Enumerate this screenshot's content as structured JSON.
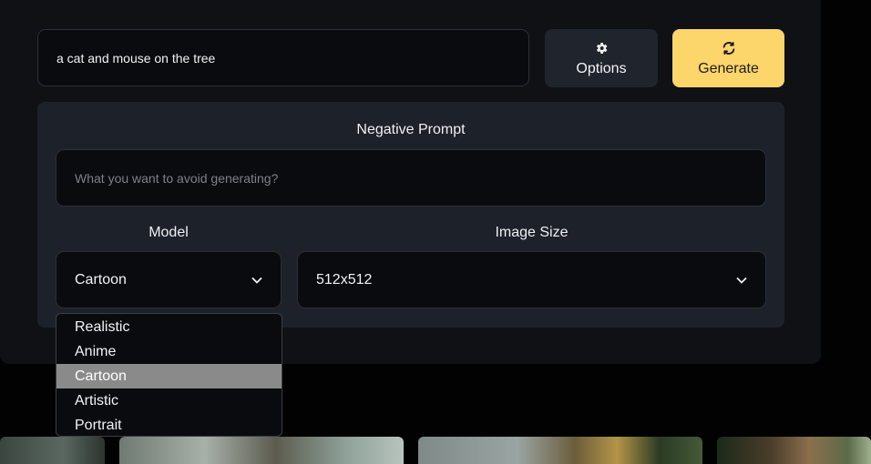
{
  "prompt": {
    "value": "a cat and mouse on the tree"
  },
  "buttons": {
    "options": {
      "label": "Options",
      "icon": "gear-icon"
    },
    "generate": {
      "label": "Generate",
      "icon": "refresh-icon"
    }
  },
  "negative_prompt": {
    "label": "Negative Prompt",
    "placeholder": "What you want to avoid generating?"
  },
  "model": {
    "label": "Model",
    "selected": "Cartoon",
    "options": [
      "Realistic",
      "Anime",
      "Cartoon",
      "Artistic",
      "Portrait"
    ]
  },
  "image_size": {
    "label": "Image Size",
    "selected": "512x512"
  },
  "colors": {
    "generate_bg": "#fcd56b",
    "panel_bg": "#0f1115",
    "settings_bg": "#1d212a",
    "selected_option_bg": "#8a8a8a"
  }
}
